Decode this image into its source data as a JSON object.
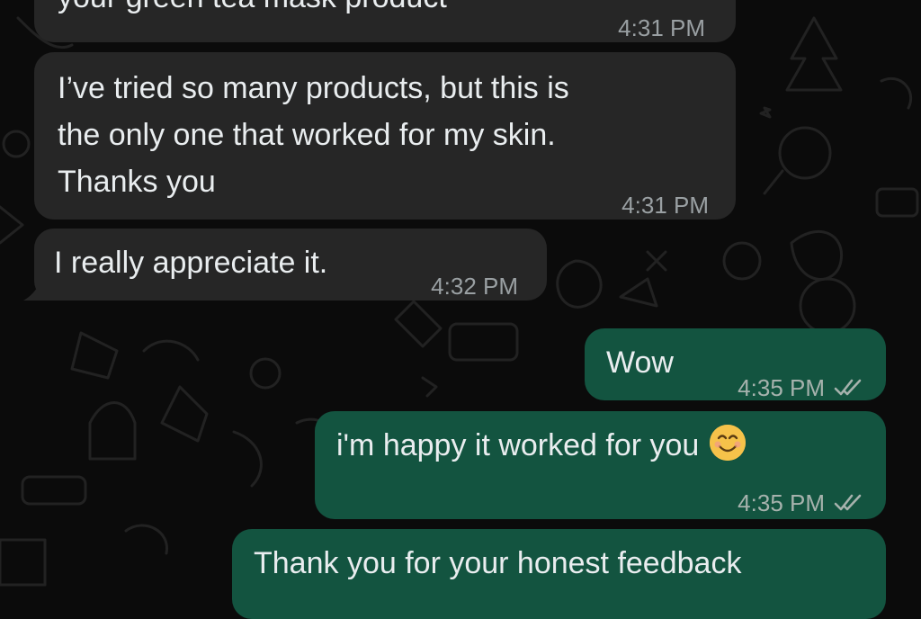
{
  "chat": {
    "messages": [
      {
        "direction": "incoming",
        "text": "your green tea mask product",
        "time": "4:31 PM"
      },
      {
        "direction": "incoming",
        "lines": [
          "I’ve tried so many products, but this is",
          "the only one that worked for my skin.",
          "Thanks you"
        ],
        "time": "4:31 PM"
      },
      {
        "direction": "incoming",
        "text": "I really appreciate it.",
        "time": "4:32 PM"
      },
      {
        "direction": "outgoing",
        "text": "Wow",
        "time": "4:35 PM",
        "status": "read"
      },
      {
        "direction": "outgoing",
        "text": "i'm happy it worked for you",
        "emoji": "smiling-face-icon",
        "time": "4:35 PM",
        "status": "read"
      },
      {
        "direction": "outgoing",
        "text": "Thank you for your honest feedback"
      }
    ]
  },
  "colors": {
    "background": "#0b0b0b",
    "incoming_bubble": "#262626",
    "outgoing_bubble": "#135440",
    "text": "#e9edef",
    "timestamp": "#9aa0a3"
  },
  "icons": {
    "read_receipt": "double-check-icon"
  }
}
